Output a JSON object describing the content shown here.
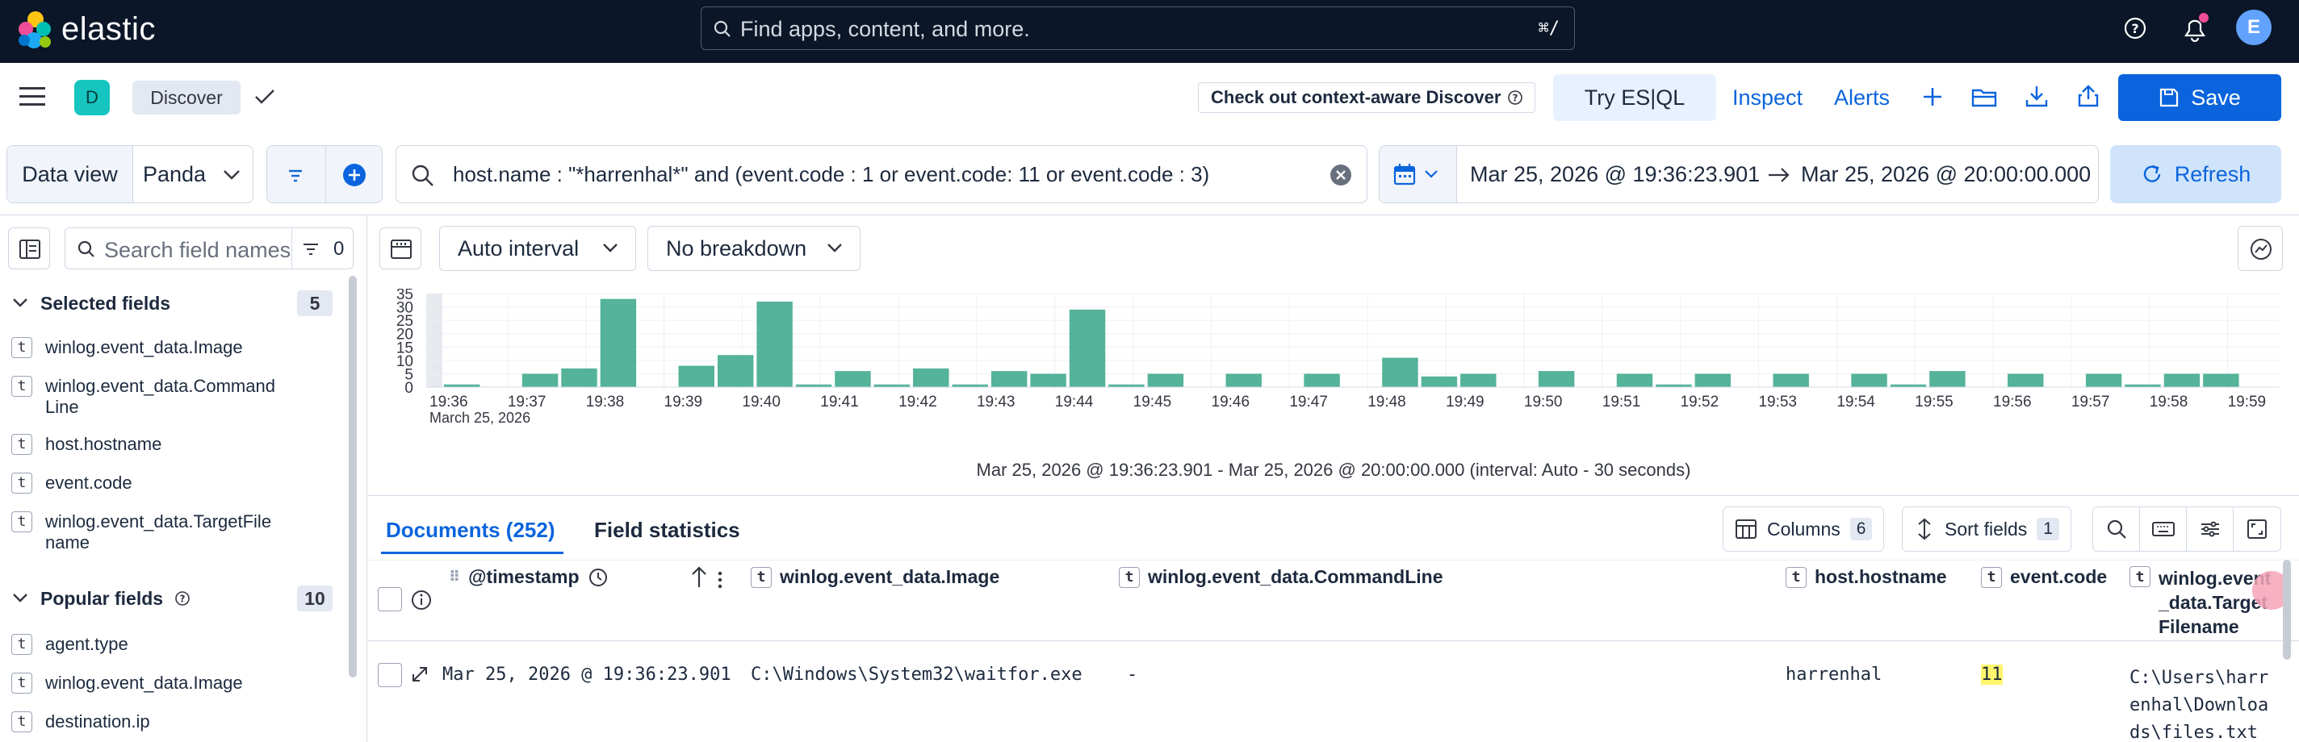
{
  "topbar": {
    "brand": "elastic",
    "search_placeholder": "Find apps, content, and more.",
    "shortcut": "⌘/",
    "user_initial": "E"
  },
  "appbar": {
    "space_initial": "D",
    "app_name": "Discover",
    "callout": "Check out context-aware Discover",
    "try_esql": "Try ES|QL",
    "inspect": "Inspect",
    "alerts": "Alerts",
    "save": "Save"
  },
  "query": {
    "data_view_label": "Data view",
    "data_view_value": "Panda",
    "text": "host.name : \"*harrenhal*\" and (event.code : 1 or event.code: 11 or event.code : 3)",
    "date_start": "Mar 25, 2026 @ 19:36:23.901",
    "date_end": "Mar 25, 2026 @ 20:00:00.000",
    "refresh": "Refresh"
  },
  "sidebar": {
    "search_placeholder": "Search field names",
    "filter_count": "0",
    "selected": {
      "title": "Selected fields",
      "count": "5",
      "items": [
        {
          "label": "winlog.event_data.Image"
        },
        {
          "label": "winlog.event_data.CommandLine"
        },
        {
          "label": "host.hostname"
        },
        {
          "label": "event.code"
        },
        {
          "label": "winlog.event_data.TargetFilename"
        }
      ]
    },
    "popular": {
      "title": "Popular fields",
      "count": "10",
      "items": [
        {
          "label": "agent.type"
        },
        {
          "label": "winlog.event_data.Image"
        },
        {
          "label": "destination.ip"
        }
      ]
    }
  },
  "chart": {
    "interval": "Auto interval",
    "breakdown": "No breakdown",
    "summary": "Mar 25, 2026 @ 19:36:23.901 - Mar 25, 2026 @ 20:00:00.000 (interval: Auto - 30 seconds)",
    "date_label": "March 25, 2026",
    "bar_color": "#54b399"
  },
  "chart_data": {
    "type": "bar",
    "title": "",
    "xlabel": "",
    "ylabel": "",
    "ylim": [
      0,
      35
    ],
    "y_ticks": [
      0,
      5,
      10,
      15,
      20,
      25,
      30,
      35
    ],
    "x_tick_labels": [
      "19:36",
      "19:37",
      "19:38",
      "19:39",
      "19:40",
      "19:41",
      "19:42",
      "19:43",
      "19:44",
      "19:45",
      "19:46",
      "19:47",
      "19:48",
      "19:49",
      "19:50",
      "19:51",
      "19:52",
      "19:53",
      "19:54",
      "19:55",
      "19:56",
      "19:57",
      "19:58",
      "19:59"
    ],
    "values": [
      1,
      0,
      5,
      7,
      33,
      0,
      8,
      12,
      32,
      1,
      6,
      1,
      7,
      1,
      6,
      5,
      29,
      1,
      5,
      0,
      5,
      0,
      5,
      0,
      11,
      4,
      5,
      0,
      6,
      0,
      5,
      1,
      5,
      0,
      5,
      0,
      5,
      1,
      6,
      0,
      5,
      0,
      5,
      1,
      5,
      5
    ],
    "bar_start": "19:36:30",
    "bar_interval_seconds": 30
  },
  "documents": {
    "tab_docs": "Documents (252)",
    "tab_stats": "Field statistics",
    "columns_label": "Columns",
    "columns_count": "6",
    "sort_label": "Sort fields",
    "sort_count": "1",
    "headers": {
      "timestamp": "@timestamp",
      "image": "winlog.event_data.Image",
      "cmdline": "winlog.event_data.CommandLine",
      "hostname": "host.hostname",
      "code": "event.code",
      "target": "winlog.event_data.TargetFilename"
    },
    "rows": [
      {
        "timestamp": "Mar 25, 2026 @ 19:36:23.901",
        "image": "C:\\Windows\\System32\\waitfor.exe",
        "cmdline": "-",
        "hostname": "harrenhal",
        "code": "11",
        "target": "C:\\Users\\harrenhal\\Downloads\\files.txt"
      }
    ]
  }
}
